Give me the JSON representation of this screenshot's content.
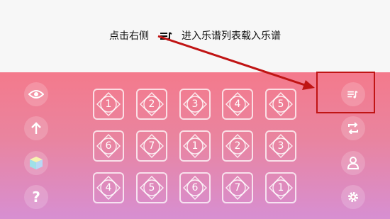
{
  "hint": {
    "before": "点击右侧",
    "after": "进入乐谱列表载入乐谱",
    "icon": "playlist-music-icon"
  },
  "left_toolbar": [
    {
      "name": "eye-icon"
    },
    {
      "name": "arrow-up-icon"
    },
    {
      "name": "cube-icon"
    },
    {
      "name": "question-icon",
      "label": "?"
    }
  ],
  "right_toolbar": [
    {
      "name": "playlist-music-icon"
    },
    {
      "name": "repeat-icon"
    },
    {
      "name": "user-icon"
    },
    {
      "name": "gear-icon"
    }
  ],
  "pads": [
    [
      "1",
      "2",
      "3",
      "4",
      "5"
    ],
    [
      "6",
      "7",
      "1",
      "2",
      "3"
    ],
    [
      "4",
      "5",
      "6",
      "7",
      "1"
    ]
  ],
  "colors": {
    "panel_top": "#f47a8c",
    "panel_bottom": "#d78fd2",
    "highlight": "#c01414"
  }
}
